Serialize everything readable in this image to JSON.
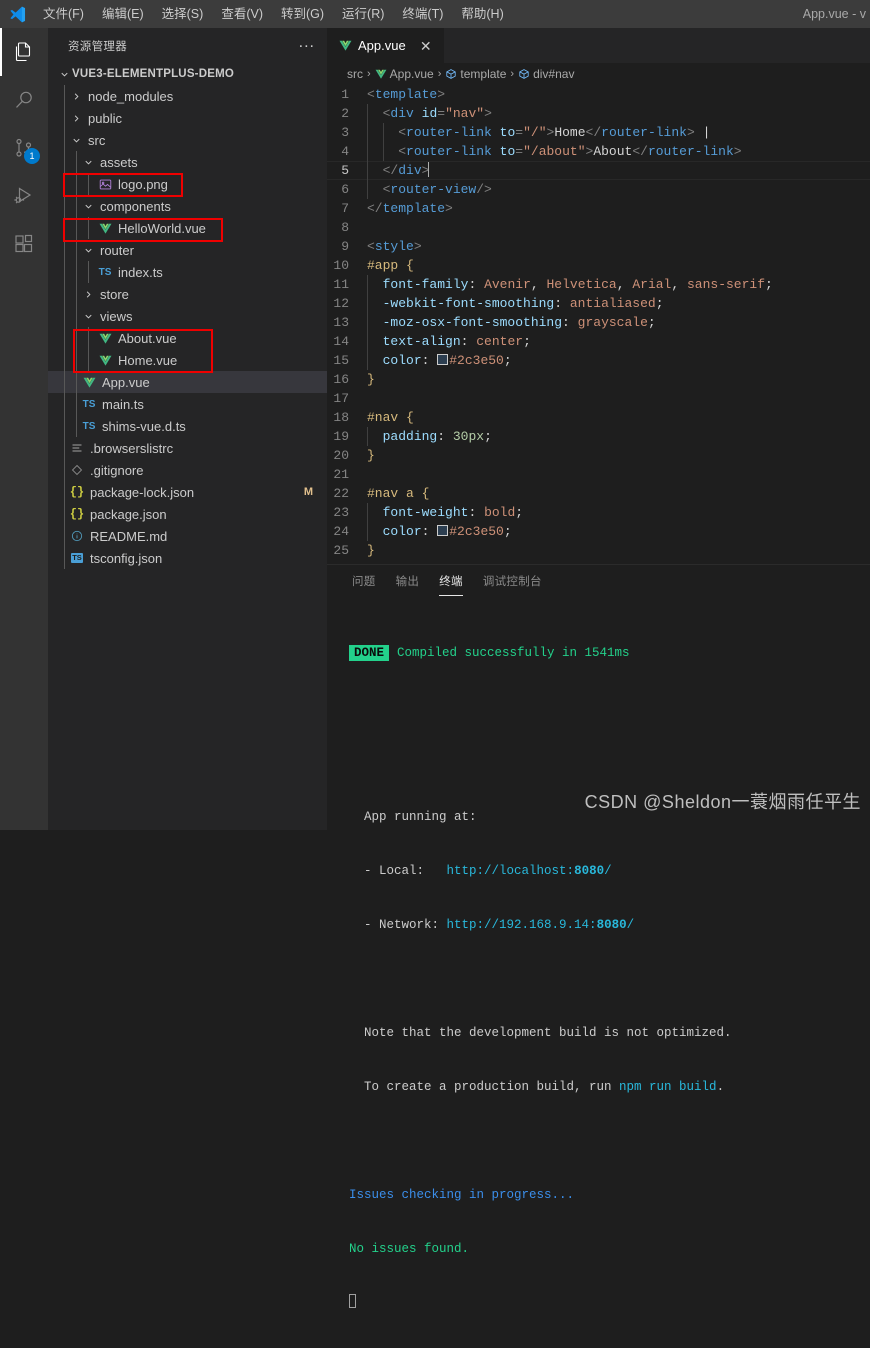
{
  "titlebar": {
    "menus": [
      "文件(F)",
      "编辑(E)",
      "选择(S)",
      "查看(V)",
      "转到(G)",
      "运行(R)",
      "终端(T)",
      "帮助(H)"
    ],
    "window_title": "App.vue - v"
  },
  "activitybar": {
    "items": [
      {
        "name": "explorer",
        "icon": "files-icon",
        "active": true,
        "badge": ""
      },
      {
        "name": "search",
        "icon": "search-icon",
        "active": false,
        "badge": ""
      },
      {
        "name": "source-control",
        "icon": "source-control-icon",
        "active": false,
        "badge": "1"
      },
      {
        "name": "run-debug",
        "icon": "run-debug-icon",
        "active": false,
        "badge": ""
      },
      {
        "name": "extensions",
        "icon": "extensions-icon",
        "active": false,
        "badge": ""
      }
    ]
  },
  "sidebar": {
    "title": "资源管理器",
    "more_actions": "...",
    "root_folder": "VUE3-ELEMENTPLUS-DEMO",
    "tree": [
      {
        "label": "node_modules",
        "type": "folder",
        "expanded": false,
        "depth": 1
      },
      {
        "label": "public",
        "type": "folder",
        "expanded": false,
        "depth": 1
      },
      {
        "label": "src",
        "type": "folder",
        "expanded": true,
        "depth": 1
      },
      {
        "label": "assets",
        "type": "folder",
        "expanded": true,
        "depth": 2
      },
      {
        "label": "logo.png",
        "type": "image",
        "depth": 3,
        "highlighted": true
      },
      {
        "label": "components",
        "type": "folder",
        "expanded": true,
        "depth": 2
      },
      {
        "label": "HelloWorld.vue",
        "type": "vue",
        "depth": 3,
        "highlighted": true
      },
      {
        "label": "router",
        "type": "folder",
        "expanded": true,
        "depth": 2
      },
      {
        "label": "index.ts",
        "type": "ts",
        "depth": 3
      },
      {
        "label": "store",
        "type": "folder",
        "expanded": false,
        "depth": 2
      },
      {
        "label": "views",
        "type": "folder",
        "expanded": true,
        "depth": 2
      },
      {
        "label": "About.vue",
        "type": "vue",
        "depth": 3,
        "highlighted": true
      },
      {
        "label": "Home.vue",
        "type": "vue",
        "depth": 3,
        "highlighted": true
      },
      {
        "label": "App.vue",
        "type": "vue",
        "depth": 2,
        "selected": true
      },
      {
        "label": "main.ts",
        "type": "ts",
        "depth": 2
      },
      {
        "label": "shims-vue.d.ts",
        "type": "ts",
        "depth": 2
      },
      {
        "label": ".browserslistrc",
        "type": "list",
        "depth": 1
      },
      {
        "label": ".gitignore",
        "type": "git",
        "depth": 1
      },
      {
        "label": "package-lock.json",
        "type": "json",
        "depth": 1,
        "badge": "M"
      },
      {
        "label": "package.json",
        "type": "json",
        "depth": 1
      },
      {
        "label": "README.md",
        "type": "md",
        "depth": 1
      },
      {
        "label": "tsconfig.json",
        "type": "tsjson",
        "depth": 1
      }
    ]
  },
  "editor": {
    "tab": {
      "label": "App.vue",
      "icon": "vue-icon",
      "close": "✕"
    },
    "breadcrumbs": [
      {
        "label": "src",
        "icon": ""
      },
      {
        "label": "App.vue",
        "icon": "vue-icon"
      },
      {
        "label": "template",
        "icon": "symbol-icon"
      },
      {
        "label": "div#nav",
        "icon": "symbol-icon"
      }
    ],
    "breadcrumb_separator": "›",
    "lines": [
      {
        "n": "1",
        "guides": 0,
        "cur": false
      },
      {
        "n": "2",
        "guides": 1,
        "cur": false
      },
      {
        "n": "3",
        "guides": 2,
        "cur": false
      },
      {
        "n": "4",
        "guides": 2,
        "cur": false
      },
      {
        "n": "5",
        "guides": 1,
        "cur": true
      },
      {
        "n": "6",
        "guides": 1,
        "cur": false
      },
      {
        "n": "7",
        "guides": 0,
        "cur": false
      },
      {
        "n": "8",
        "guides": 0,
        "cur": false
      },
      {
        "n": "9",
        "guides": 0,
        "cur": false
      },
      {
        "n": "10",
        "guides": 0,
        "cur": false
      },
      {
        "n": "11",
        "guides": 1,
        "cur": false
      },
      {
        "n": "12",
        "guides": 1,
        "cur": false
      },
      {
        "n": "13",
        "guides": 1,
        "cur": false
      },
      {
        "n": "14",
        "guides": 1,
        "cur": false
      },
      {
        "n": "15",
        "guides": 1,
        "cur": false
      },
      {
        "n": "16",
        "guides": 0,
        "cur": false
      },
      {
        "n": "17",
        "guides": 0,
        "cur": false
      },
      {
        "n": "18",
        "guides": 0,
        "cur": false
      },
      {
        "n": "19",
        "guides": 1,
        "cur": false
      },
      {
        "n": "20",
        "guides": 0,
        "cur": false
      },
      {
        "n": "21",
        "guides": 0,
        "cur": false
      },
      {
        "n": "22",
        "guides": 0,
        "cur": false
      },
      {
        "n": "23",
        "guides": 1,
        "cur": false
      },
      {
        "n": "24",
        "guides": 1,
        "cur": false
      },
      {
        "n": "25",
        "guides": 0,
        "cur": false
      }
    ],
    "code_text": {
      "l1": "<template>",
      "l2": "  <div id=\"nav\">",
      "l3": "    <router-link to=\"/\">Home</router-link> |",
      "l4": "    <router-link to=\"/about\">About</router-link>",
      "l5": "  </div>",
      "l6": "  <router-view/>",
      "l7": "</template>",
      "l8": "",
      "l9": "<style>",
      "l10": "#app {",
      "l11": "  font-family: Avenir, Helvetica, Arial, sans-serif;",
      "l12": "  -webkit-font-smoothing: antialiased;",
      "l13": "  -moz-osx-font-smoothing: grayscale;",
      "l14": "  text-align: center;",
      "l15": "  color: #2c3e50;",
      "l16": "}",
      "l17": "",
      "l18": "#nav {",
      "l19": "  padding: 30px;",
      "l20": "}",
      "l21": "",
      "l22": "#nav a {",
      "l23": "  font-weight: bold;",
      "l24": "  color: #2c3e50;",
      "l25": "}"
    },
    "color_swatch_hex": "#2c3e50"
  },
  "panel": {
    "tabs": [
      {
        "label": "问题",
        "active": false
      },
      {
        "label": "输出",
        "active": false
      },
      {
        "label": "终端",
        "active": true
      },
      {
        "label": "调试控制台",
        "active": false
      }
    ],
    "terminal": {
      "done_badge": "DONE",
      "compiled_message": "Compiled successfully in 1541ms",
      "app_running_at": "  App running at:",
      "local_label": "  - Local:   ",
      "local_url_prefix": "http://localhost:",
      "local_url_port": "8080",
      "local_url_suffix": "/",
      "network_label": "  - Network: ",
      "network_url_prefix": "http://192.168.9.14:",
      "network_url_port": "8080",
      "network_url_suffix": "/",
      "note_line": "  Note that the development build is not optimized.",
      "create_line_a": "  To create a production build, run ",
      "create_line_cmd": "npm run build",
      "create_line_b": ".",
      "issues_checking": "Issues checking in progress...",
      "no_issues": "No issues found."
    }
  },
  "watermark": "CSDN @Sheldon一蓑烟雨任平生",
  "colors": {
    "accent": "#007acc",
    "titlebar_bg": "#3c3c3c",
    "activitybar_bg": "#333333",
    "sidebar_bg": "#252526",
    "editor_bg": "#1e1e1e",
    "highlight_box": "#ef0000",
    "vue_green": "#81c784",
    "done_green": "#23d18b"
  }
}
